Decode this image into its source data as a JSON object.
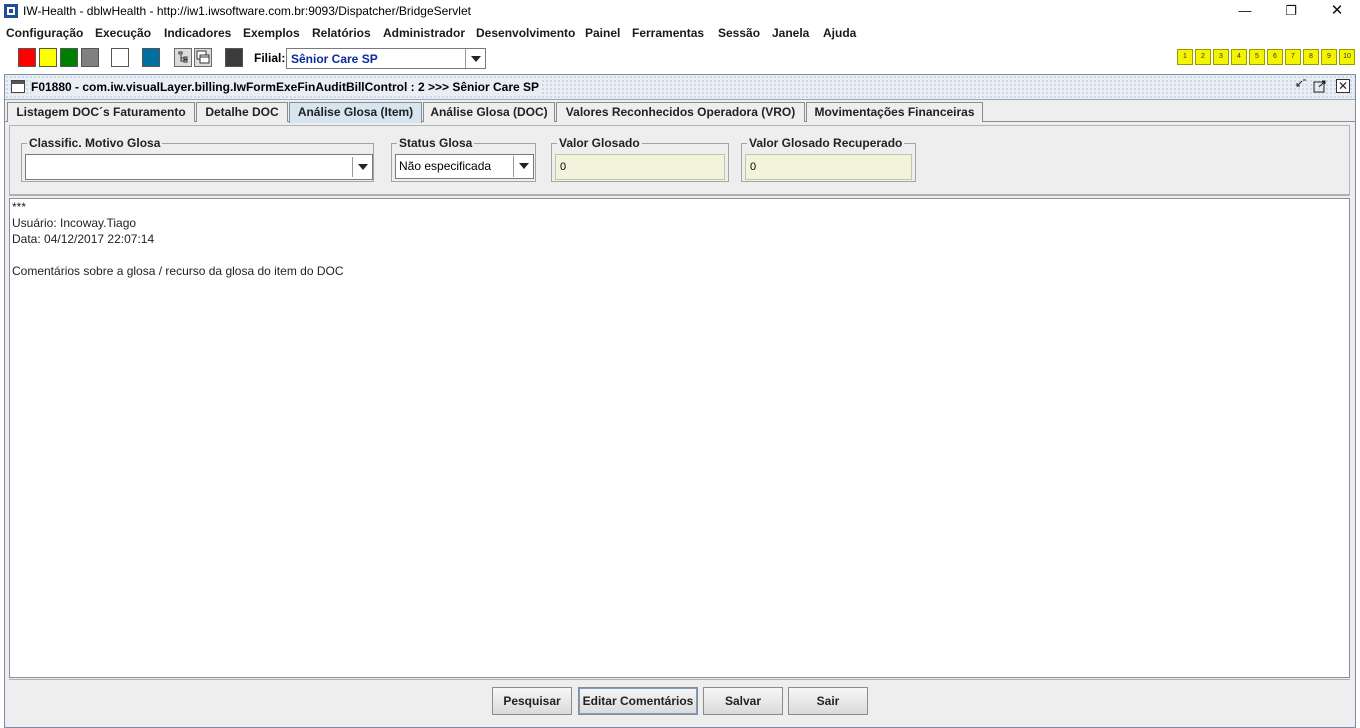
{
  "window": {
    "title": "IW-Health - dblwHealth - http://iw1.iwsoftware.com.br:9093/Dispatcher/BridgeServlet",
    "controls": [
      "minimize-icon",
      "restore-icon",
      "close-icon"
    ]
  },
  "menu": {
    "items": [
      "Configuração",
      "Execução",
      "Indicadores",
      "Exemplos",
      "Relatórios",
      "Administrador",
      "Desenvolvimento",
      "Painel",
      "Ferramentas",
      "Sessão",
      "Janela",
      "Ajuda"
    ]
  },
  "toolbar": {
    "swatch_colors": [
      "#ff0000",
      "#ffff00",
      "#008000",
      "#808080",
      "#ffffff",
      "#006e9e"
    ],
    "icons": [
      "tree-icon",
      "windows-icon",
      "dark-square-icon"
    ],
    "filial_label": "Filial:",
    "filial_value": "Sênior Care SP",
    "quick_buttons": [
      "1",
      "2",
      "3",
      "4",
      "5",
      "6",
      "7",
      "8",
      "9",
      "10"
    ],
    "quick_button_color": "#f4f400"
  },
  "frame": {
    "title": "F01880 - com.iw.visualLayer.billing.IwFormExeFinAuditBillControl : 2 >>> Sênior Care SP",
    "tabs": [
      "Listagem DOC´s Faturamento",
      "Detalhe DOC",
      "Análise Glosa (Item)",
      "Análise Glosa (DOC)",
      "Valores Reconhecidos Operadora (VRO)",
      "Movimentações Financeiras"
    ],
    "active_tab": "Análise Glosa (Item)"
  },
  "filters": {
    "motivo_label": "Classific. Motivo Glosa",
    "motivo_value": "",
    "status_label": "Status Glosa",
    "status_value": "Não especificada",
    "valor_glosado_label": "Valor Glosado",
    "valor_glosado_value": "0",
    "valor_recuperado_label": "Valor Glosado Recuperado",
    "valor_recuperado_value": "0"
  },
  "comments": {
    "lines": [
      "***",
      "Usuário: Incoway.Tiago",
      "Data: 04/12/2017 22:07:14",
      "",
      "Comentários sobre a glosa / recurso da glosa do item do DOC"
    ]
  },
  "buttons": {
    "pesquisar": "Pesquisar",
    "editar": "Editar Comentários",
    "salvar": "Salvar",
    "sair": "Sair"
  }
}
